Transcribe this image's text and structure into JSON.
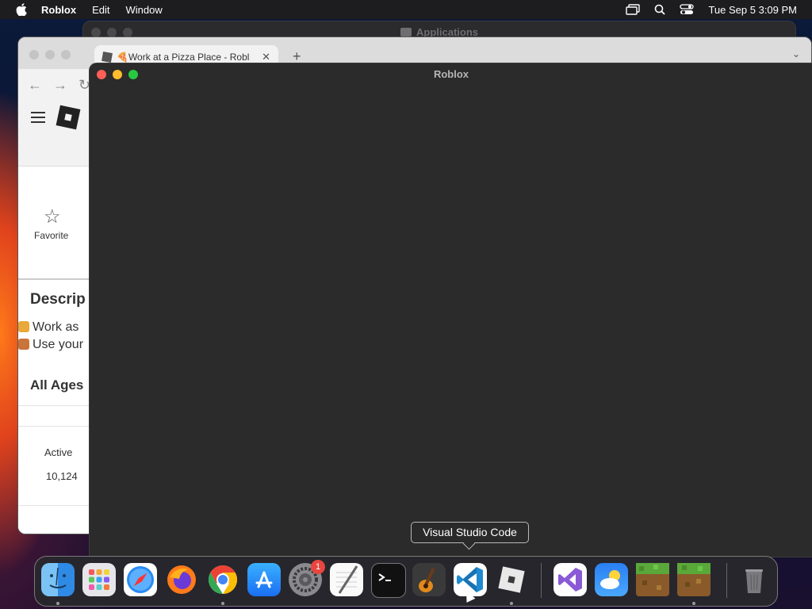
{
  "menubar": {
    "app_name": "Roblox",
    "items": [
      "Edit",
      "Window"
    ],
    "datetime": "Tue Sep 5  3:09 PM"
  },
  "finder": {
    "title": "Applications"
  },
  "browser": {
    "tab_title": "🍕Work at a Pizza Place - Robl",
    "page": {
      "favorite_label": "Favorite",
      "description_heading": "Descrip",
      "description_line1": "Work as",
      "description_line2": "Use your",
      "age_rating": "All Ages",
      "active_label": "Active",
      "active_value": "10,124"
    }
  },
  "roblox_window": {
    "title": "Roblox"
  },
  "tooltip": {
    "text": "Visual Studio Code"
  },
  "dock": {
    "settings_badge": "1",
    "apps": [
      "Finder",
      "Launchpad",
      "Safari",
      "Firefox",
      "Chrome",
      "App Store",
      "System Settings",
      "TextEdit",
      "Terminal",
      "GarageBand",
      "Visual Studio Code",
      "Roblox",
      "Visual Studio",
      "Weather",
      "Minecraft",
      "Minecraft",
      "Trash"
    ]
  },
  "colors": {
    "close": "#ff5f57",
    "minimize": "#febc2e",
    "zoom": "#28c840"
  }
}
